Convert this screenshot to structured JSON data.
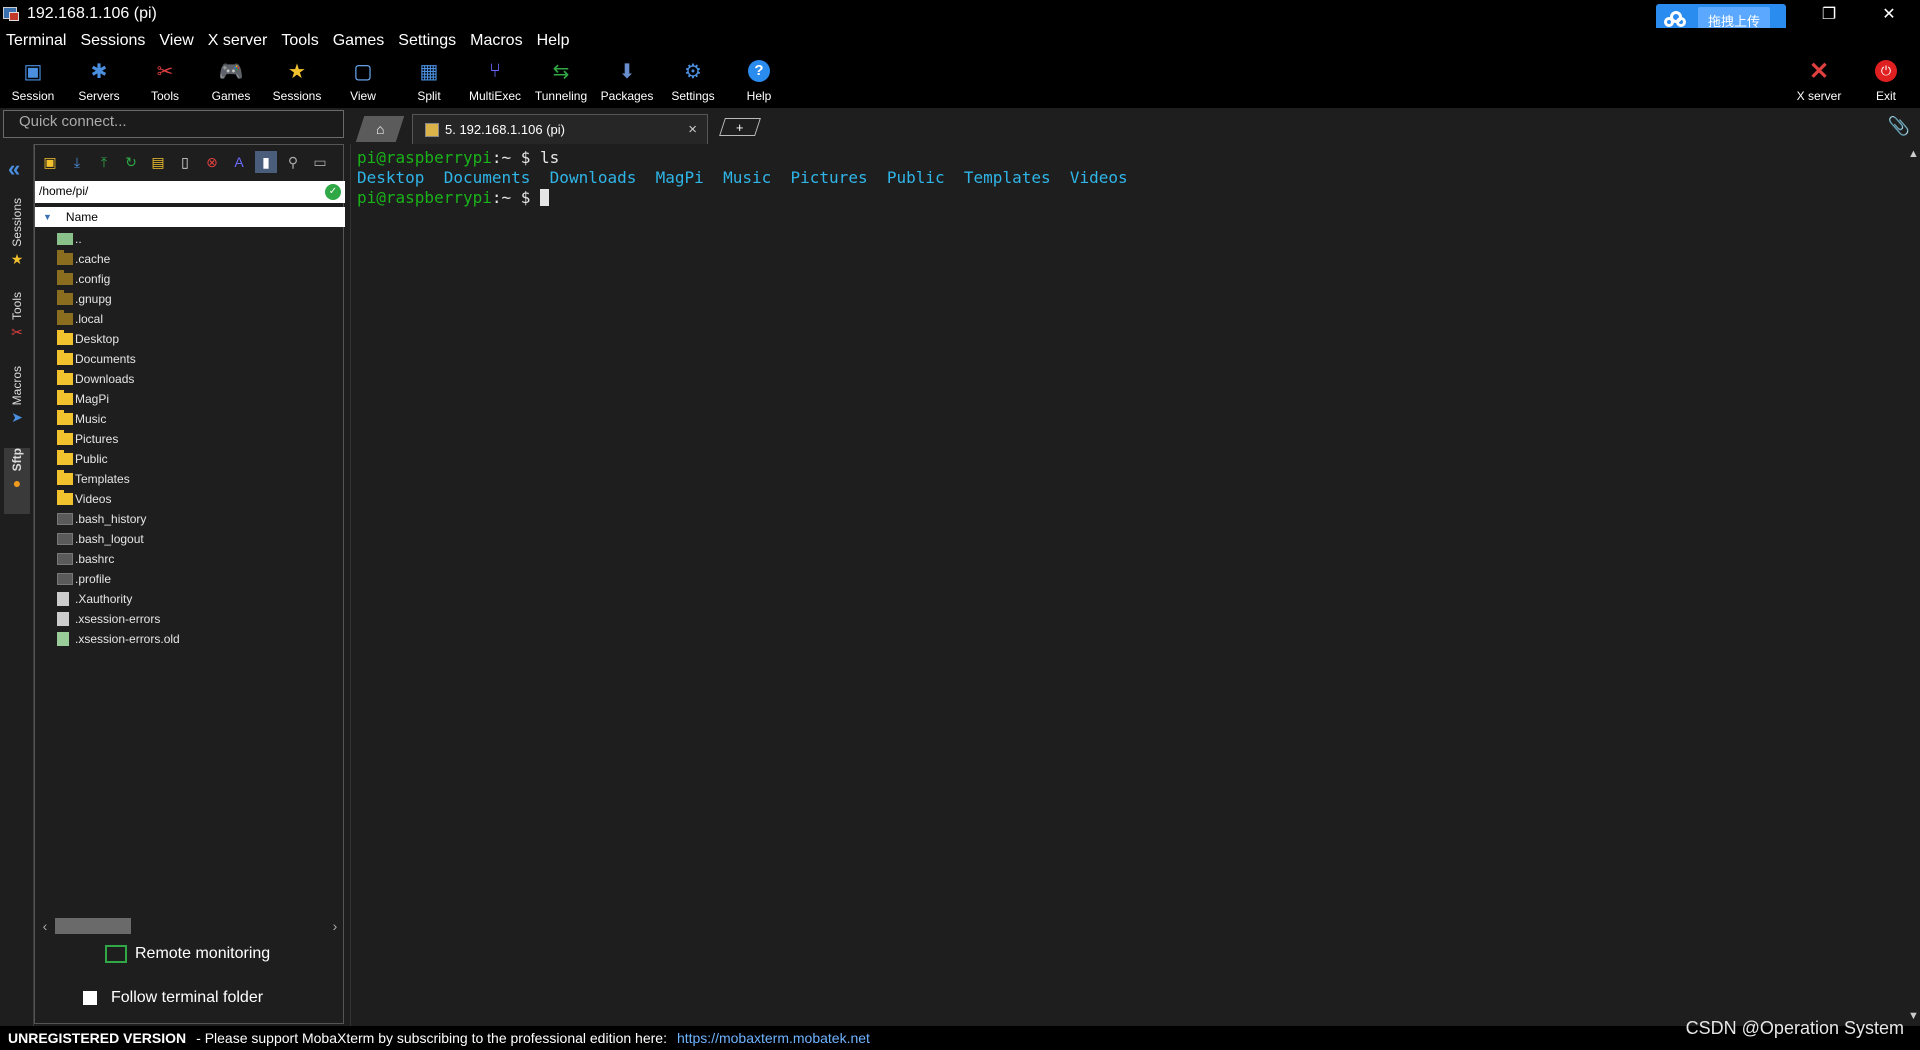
{
  "window": {
    "title": "192.168.1.106 (pi)",
    "upload_label": "拖拽上传"
  },
  "menu": [
    "Terminal",
    "Sessions",
    "View",
    "X server",
    "Tools",
    "Games",
    "Settings",
    "Macros",
    "Help"
  ],
  "toolbar": [
    {
      "label": "Session",
      "color": "#4a8fe0"
    },
    {
      "label": "Servers",
      "color": "#4a8fe0"
    },
    {
      "label": "Tools",
      "color": "#e04040"
    },
    {
      "label": "Games",
      "color": "#e0e0e0"
    },
    {
      "label": "Sessions",
      "color": "#f2c12e"
    },
    {
      "label": "View",
      "color": "#6fb3ff"
    },
    {
      "label": "Split",
      "color": "#4a8fe0"
    },
    {
      "label": "MultiExec",
      "color": "#6a6aff"
    },
    {
      "label": "Tunneling",
      "color": "#2fa845"
    },
    {
      "label": "Packages",
      "color": "#6a8fd0"
    },
    {
      "label": "Settings",
      "color": "#4a8fe0"
    },
    {
      "label": "Help",
      "color": "#2b8cf0"
    }
  ],
  "toolbar_right": {
    "xserver": "X server",
    "exit": "Exit"
  },
  "quick_connect": {
    "placeholder": "Quick connect..."
  },
  "tabs": {
    "session_label": "5. 192.168.1.106 (pi)",
    "close": "×",
    "new": "+"
  },
  "side_tabs": [
    "Sessions",
    "Tools",
    "Macros",
    "Sftp"
  ],
  "sftp": {
    "path": "/home/pi/",
    "column": "Name",
    "files": [
      {
        "name": "..",
        "type": "up"
      },
      {
        "name": ".cache",
        "type": "hid"
      },
      {
        "name": ".config",
        "type": "hid"
      },
      {
        "name": ".gnupg",
        "type": "hid"
      },
      {
        "name": ".local",
        "type": "hid"
      },
      {
        "name": "Desktop",
        "type": "dir"
      },
      {
        "name": "Documents",
        "type": "dir"
      },
      {
        "name": "Downloads",
        "type": "dir"
      },
      {
        "name": "MagPi",
        "type": "dir"
      },
      {
        "name": "Music",
        "type": "dir"
      },
      {
        "name": "Pictures",
        "type": "dir"
      },
      {
        "name": "Public",
        "type": "dir"
      },
      {
        "name": "Templates",
        "type": "dir"
      },
      {
        "name": "Videos",
        "type": "dir"
      },
      {
        "name": ".bash_history",
        "type": "file"
      },
      {
        "name": ".bash_logout",
        "type": "file"
      },
      {
        "name": ".bashrc",
        "type": "file"
      },
      {
        "name": ".profile",
        "type": "file"
      },
      {
        "name": ".Xauthority",
        "type": "doc"
      },
      {
        "name": ".xsession-errors",
        "type": "doc"
      },
      {
        "name": ".xsession-errors.old",
        "type": "olddoc"
      }
    ],
    "remote_monitoring": "Remote monitoring",
    "follow_folder": "Follow terminal folder"
  },
  "terminal": {
    "prompt": "pi@raspberrypi",
    "suffix": ":~ $ ",
    "command": "ls",
    "ls_output": [
      "Desktop",
      "Documents",
      "Downloads",
      "MagPi",
      "Music",
      "Pictures",
      "Public",
      "Templates",
      "Videos"
    ]
  },
  "status": {
    "unregistered": "UNREGISTERED VERSION",
    "message": "-  Please support MobaXterm by subscribing to the professional edition here:",
    "link": "https://mobaxterm.mobatek.net"
  },
  "watermark": "CSDN @Operation System"
}
